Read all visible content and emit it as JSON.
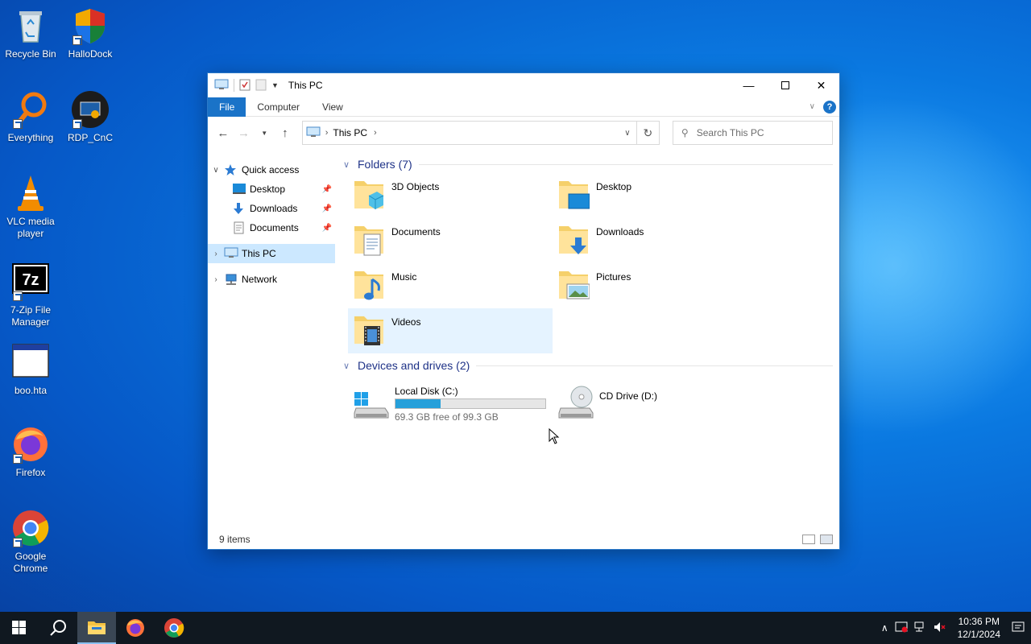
{
  "desktop": {
    "icons": [
      {
        "label": "Recycle Bin",
        "icon": "recycle-bin-icon"
      },
      {
        "label": "HalloDock",
        "icon": "shield-icon"
      },
      {
        "label": "Everything",
        "icon": "magnifier-icon"
      },
      {
        "label": "RDP_CnC",
        "icon": "rdp-icon"
      },
      {
        "label": "VLC media player",
        "icon": "vlc-cone-icon"
      },
      {
        "label": "7-Zip File Manager",
        "icon": "7zip-icon"
      },
      {
        "label": "boo.hta",
        "icon": "window-icon"
      },
      {
        "label": "Firefox",
        "icon": "firefox-icon"
      },
      {
        "label": "Google Chrome",
        "icon": "chrome-icon"
      }
    ]
  },
  "window": {
    "title": "This PC",
    "ribbon_tabs": [
      "File",
      "Computer",
      "View"
    ],
    "address": {
      "crumb": "This PC"
    },
    "search_placeholder": "Search This PC"
  },
  "nav": {
    "items": [
      {
        "label": "Quick access",
        "arrow": "expanded"
      },
      {
        "label": "Desktop",
        "pinned": true
      },
      {
        "label": "Downloads",
        "pinned": true
      },
      {
        "label": "Documents",
        "pinned": true
      },
      {
        "label": "This PC",
        "arrow": "collapsed",
        "selected": true
      },
      {
        "label": "Network",
        "arrow": "collapsed"
      }
    ]
  },
  "content": {
    "folders_header": "Folders (7)",
    "folders": [
      {
        "name": "3D Objects",
        "icon": "3d-objects-folder-icon"
      },
      {
        "name": "Desktop",
        "icon": "desktop-folder-icon"
      },
      {
        "name": "Documents",
        "icon": "documents-folder-icon"
      },
      {
        "name": "Downloads",
        "icon": "downloads-folder-icon"
      },
      {
        "name": "Music",
        "icon": "music-folder-icon"
      },
      {
        "name": "Pictures",
        "icon": "pictures-folder-icon"
      },
      {
        "name": "Videos",
        "icon": "videos-folder-icon"
      }
    ],
    "drives_header": "Devices and drives (2)",
    "drives": [
      {
        "name": "Local Disk (C:)",
        "free": "69.3 GB free of 99.3 GB",
        "used_fraction": 0.302
      },
      {
        "name": "CD Drive (D:)"
      }
    ]
  },
  "status": {
    "items": "9 items"
  },
  "taskbar": {
    "time": "10:36 PM",
    "date": "12/1/2024"
  },
  "colors": {
    "accent": "#1a73c8",
    "selection": "#cce8ff",
    "hover": "#e5f3ff",
    "drive_fill": "#26a0da"
  }
}
